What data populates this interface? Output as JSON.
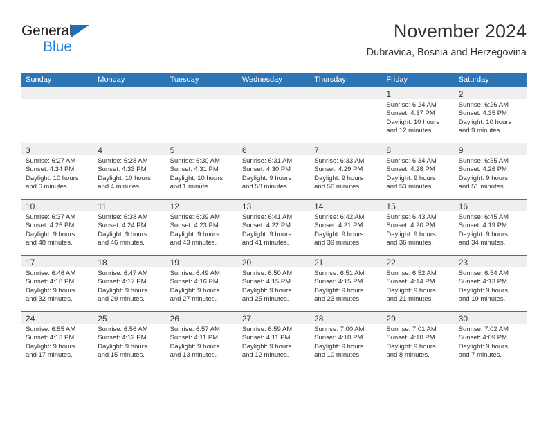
{
  "brand": {
    "name_part1": "General",
    "name_part2": "Blue",
    "triangle_icon": "triangle-icon",
    "accent_color": "#1c7fd6"
  },
  "header": {
    "title": "November 2024",
    "subtitle": "Dubravica, Bosnia and Herzegovina"
  },
  "calendar": {
    "header_bg": "#2e75b6",
    "daynum_bg": "#efefef",
    "weekday_headers": [
      "Sunday",
      "Monday",
      "Tuesday",
      "Wednesday",
      "Thursday",
      "Friday",
      "Saturday"
    ],
    "weeks": [
      [
        {
          "day": "",
          "lines": []
        },
        {
          "day": "",
          "lines": []
        },
        {
          "day": "",
          "lines": []
        },
        {
          "day": "",
          "lines": []
        },
        {
          "day": "",
          "lines": []
        },
        {
          "day": "1",
          "lines": [
            "Sunrise: 6:24 AM",
            "Sunset: 4:37 PM",
            "Daylight: 10 hours",
            "and 12 minutes."
          ]
        },
        {
          "day": "2",
          "lines": [
            "Sunrise: 6:26 AM",
            "Sunset: 4:35 PM",
            "Daylight: 10 hours",
            "and 9 minutes."
          ]
        }
      ],
      [
        {
          "day": "3",
          "lines": [
            "Sunrise: 6:27 AM",
            "Sunset: 4:34 PM",
            "Daylight: 10 hours",
            "and 6 minutes."
          ]
        },
        {
          "day": "4",
          "lines": [
            "Sunrise: 6:28 AM",
            "Sunset: 4:33 PM",
            "Daylight: 10 hours",
            "and 4 minutes."
          ]
        },
        {
          "day": "5",
          "lines": [
            "Sunrise: 6:30 AM",
            "Sunset: 4:31 PM",
            "Daylight: 10 hours",
            "and 1 minute."
          ]
        },
        {
          "day": "6",
          "lines": [
            "Sunrise: 6:31 AM",
            "Sunset: 4:30 PM",
            "Daylight: 9 hours",
            "and 58 minutes."
          ]
        },
        {
          "day": "7",
          "lines": [
            "Sunrise: 6:33 AM",
            "Sunset: 4:29 PM",
            "Daylight: 9 hours",
            "and 56 minutes."
          ]
        },
        {
          "day": "8",
          "lines": [
            "Sunrise: 6:34 AM",
            "Sunset: 4:28 PM",
            "Daylight: 9 hours",
            "and 53 minutes."
          ]
        },
        {
          "day": "9",
          "lines": [
            "Sunrise: 6:35 AM",
            "Sunset: 4:26 PM",
            "Daylight: 9 hours",
            "and 51 minutes."
          ]
        }
      ],
      [
        {
          "day": "10",
          "lines": [
            "Sunrise: 6:37 AM",
            "Sunset: 4:25 PM",
            "Daylight: 9 hours",
            "and 48 minutes."
          ]
        },
        {
          "day": "11",
          "lines": [
            "Sunrise: 6:38 AM",
            "Sunset: 4:24 PM",
            "Daylight: 9 hours",
            "and 46 minutes."
          ]
        },
        {
          "day": "12",
          "lines": [
            "Sunrise: 6:39 AM",
            "Sunset: 4:23 PM",
            "Daylight: 9 hours",
            "and 43 minutes."
          ]
        },
        {
          "day": "13",
          "lines": [
            "Sunrise: 6:41 AM",
            "Sunset: 4:22 PM",
            "Daylight: 9 hours",
            "and 41 minutes."
          ]
        },
        {
          "day": "14",
          "lines": [
            "Sunrise: 6:42 AM",
            "Sunset: 4:21 PM",
            "Daylight: 9 hours",
            "and 39 minutes."
          ]
        },
        {
          "day": "15",
          "lines": [
            "Sunrise: 6:43 AM",
            "Sunset: 4:20 PM",
            "Daylight: 9 hours",
            "and 36 minutes."
          ]
        },
        {
          "day": "16",
          "lines": [
            "Sunrise: 6:45 AM",
            "Sunset: 4:19 PM",
            "Daylight: 9 hours",
            "and 34 minutes."
          ]
        }
      ],
      [
        {
          "day": "17",
          "lines": [
            "Sunrise: 6:46 AM",
            "Sunset: 4:18 PM",
            "Daylight: 9 hours",
            "and 32 minutes."
          ]
        },
        {
          "day": "18",
          "lines": [
            "Sunrise: 6:47 AM",
            "Sunset: 4:17 PM",
            "Daylight: 9 hours",
            "and 29 minutes."
          ]
        },
        {
          "day": "19",
          "lines": [
            "Sunrise: 6:49 AM",
            "Sunset: 4:16 PM",
            "Daylight: 9 hours",
            "and 27 minutes."
          ]
        },
        {
          "day": "20",
          "lines": [
            "Sunrise: 6:50 AM",
            "Sunset: 4:15 PM",
            "Daylight: 9 hours",
            "and 25 minutes."
          ]
        },
        {
          "day": "21",
          "lines": [
            "Sunrise: 6:51 AM",
            "Sunset: 4:15 PM",
            "Daylight: 9 hours",
            "and 23 minutes."
          ]
        },
        {
          "day": "22",
          "lines": [
            "Sunrise: 6:52 AM",
            "Sunset: 4:14 PM",
            "Daylight: 9 hours",
            "and 21 minutes."
          ]
        },
        {
          "day": "23",
          "lines": [
            "Sunrise: 6:54 AM",
            "Sunset: 4:13 PM",
            "Daylight: 9 hours",
            "and 19 minutes."
          ]
        }
      ],
      [
        {
          "day": "24",
          "lines": [
            "Sunrise: 6:55 AM",
            "Sunset: 4:13 PM",
            "Daylight: 9 hours",
            "and 17 minutes."
          ]
        },
        {
          "day": "25",
          "lines": [
            "Sunrise: 6:56 AM",
            "Sunset: 4:12 PM",
            "Daylight: 9 hours",
            "and 15 minutes."
          ]
        },
        {
          "day": "26",
          "lines": [
            "Sunrise: 6:57 AM",
            "Sunset: 4:11 PM",
            "Daylight: 9 hours",
            "and 13 minutes."
          ]
        },
        {
          "day": "27",
          "lines": [
            "Sunrise: 6:59 AM",
            "Sunset: 4:11 PM",
            "Daylight: 9 hours",
            "and 12 minutes."
          ]
        },
        {
          "day": "28",
          "lines": [
            "Sunrise: 7:00 AM",
            "Sunset: 4:10 PM",
            "Daylight: 9 hours",
            "and 10 minutes."
          ]
        },
        {
          "day": "29",
          "lines": [
            "Sunrise: 7:01 AM",
            "Sunset: 4:10 PM",
            "Daylight: 9 hours",
            "and 8 minutes."
          ]
        },
        {
          "day": "30",
          "lines": [
            "Sunrise: 7:02 AM",
            "Sunset: 4:09 PM",
            "Daylight: 9 hours",
            "and 7 minutes."
          ]
        }
      ]
    ]
  }
}
